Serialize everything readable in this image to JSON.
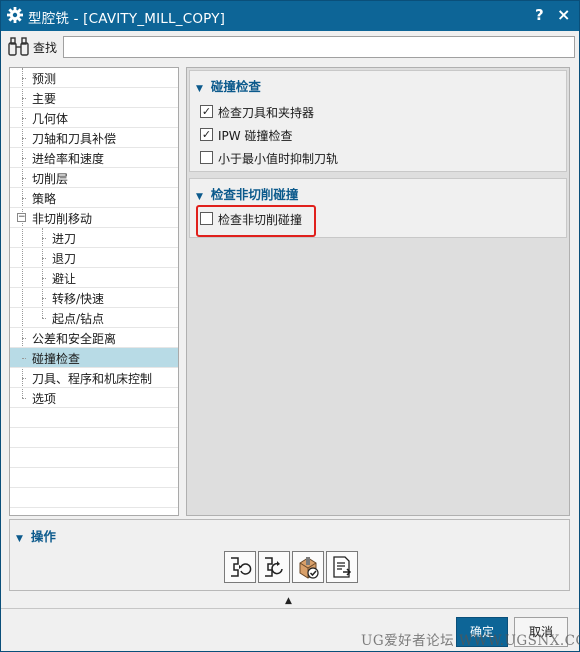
{
  "window": {
    "title": "型腔铣 - [CAVITY_MILL_COPY]",
    "help_glyph": "?",
    "close_glyph": "×"
  },
  "search": {
    "label": "查找",
    "value": ""
  },
  "tree": {
    "items": [
      {
        "label": "预测"
      },
      {
        "label": "主要"
      },
      {
        "label": "几何体"
      },
      {
        "label": "刀轴和刀具补偿"
      },
      {
        "label": "进给率和速度"
      },
      {
        "label": "切削层"
      },
      {
        "label": "策略"
      },
      {
        "label": "非切削移动",
        "expander": "−"
      },
      {
        "label": "进刀"
      },
      {
        "label": "退刀"
      },
      {
        "label": "避让"
      },
      {
        "label": "转移/快速"
      },
      {
        "label": "起点/钻点"
      },
      {
        "label": "公差和安全距离"
      },
      {
        "label": "碰撞检查",
        "selected": true
      },
      {
        "label": "刀具、程序和机床控制"
      },
      {
        "label": "选项"
      }
    ]
  },
  "groups": {
    "collision": {
      "title": "碰撞检查",
      "options": [
        {
          "label": "检查刀具和夹持器",
          "checked": true
        },
        {
          "label": "IPW 碰撞检查",
          "checked": true
        },
        {
          "label": "小于最小值时抑制刀轨",
          "checked": false
        }
      ]
    },
    "noncut": {
      "title": "检查非切削碰撞",
      "options": [
        {
          "label": "检查非切削碰撞",
          "checked": false
        }
      ]
    },
    "operations": {
      "title": "操作"
    }
  },
  "icons": {
    "settings": "gear-icon",
    "search": "binoculars-icon",
    "collapse": "triangle-up-icon",
    "ops": [
      "generate-toolpath-icon",
      "replay-toolpath-icon",
      "verify-toolpath-icon",
      "list-toolpath-icon"
    ]
  },
  "checkmark_glyph": "✓",
  "footer": {
    "ok_label": "确定",
    "cancel_label": "取消"
  },
  "watermark": "UG爱好者论坛 WWW.UGSNX.COM",
  "colors": {
    "titlebar": "#0d6597",
    "selected_row": "#b8dbe6",
    "highlight_border": "#e0201c",
    "group_header": "#0c5a8c"
  }
}
